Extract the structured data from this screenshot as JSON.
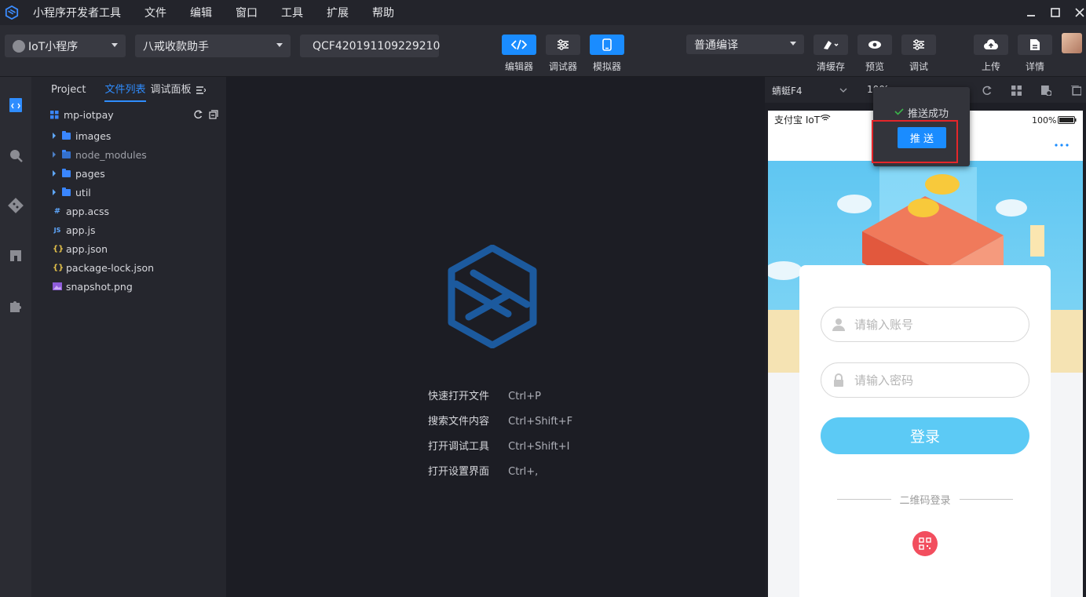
{
  "titlebar": {
    "app_title": "小程序开发者工具",
    "menu": [
      "文件",
      "编辑",
      "窗口",
      "工具",
      "扩展",
      "帮助"
    ],
    "window_controls": [
      "minimize-icon",
      "maximize-icon",
      "close-icon"
    ]
  },
  "toolbar": {
    "project_type": "IoT小程序",
    "project_name": "八戒收款助手",
    "device_id": "QCF420191109229210",
    "view_modes": [
      {
        "label": "编辑器",
        "icon": "code-icon",
        "active": true
      },
      {
        "label": "调试器",
        "icon": "sliders-icon",
        "active": true
      },
      {
        "label": "模拟器",
        "icon": "phone-icon",
        "active": true
      }
    ],
    "compile_mode": "普通编译",
    "actions": [
      {
        "label": "清缓存",
        "icon": "broom-icon"
      },
      {
        "label": "预览",
        "icon": "eye-icon"
      },
      {
        "label": "调试",
        "icon": "sliders-icon"
      },
      {
        "label": "上传",
        "icon": "cloud-upload-icon"
      },
      {
        "label": "详情",
        "icon": "document-icon"
      }
    ]
  },
  "file_panel": {
    "tabs": [
      "Project",
      "文件列表",
      "调试面板"
    ],
    "active_tab": "文件列表",
    "root": "mp-iotpay",
    "items": [
      {
        "name": "images",
        "type": "folder"
      },
      {
        "name": "node_modules",
        "type": "folder"
      },
      {
        "name": "pages",
        "type": "folder"
      },
      {
        "name": "util",
        "type": "folder"
      },
      {
        "name": "app.acss",
        "type": "acss",
        "icon_text": "#"
      },
      {
        "name": "app.js",
        "type": "js",
        "icon_text": "JS"
      },
      {
        "name": "app.json",
        "type": "json",
        "icon_text": "{}"
      },
      {
        "name": "package-lock.json",
        "type": "json",
        "icon_text": "{}"
      },
      {
        "name": "snapshot.png",
        "type": "image",
        "icon_text": ""
      }
    ]
  },
  "editor": {
    "shortcuts": [
      {
        "label": "快速打开文件",
        "key": "Ctrl+P"
      },
      {
        "label": "搜索文件内容",
        "key": "Ctrl+Shift+F"
      },
      {
        "label": "打开调试工具",
        "key": "Ctrl+Shift+I"
      },
      {
        "label": "打开设置界面",
        "key": "Ctrl+,"
      }
    ]
  },
  "simulator": {
    "device": "蜻蜓F4",
    "zoom": "100%",
    "status_left": "支付宝 IoT",
    "battery": "100%",
    "login": {
      "account_placeholder": "请输入账号",
      "password_placeholder": "请输入密码",
      "login_button": "登录",
      "qr_login": "二维码登录"
    }
  },
  "popover": {
    "success_text": "推送成功",
    "push_button": "推 送"
  },
  "colors": {
    "accent": "#1a8cff",
    "login_button": "#5ccaf5",
    "highlight_box": "#e5262a",
    "qr_button": "#f24e5e"
  }
}
